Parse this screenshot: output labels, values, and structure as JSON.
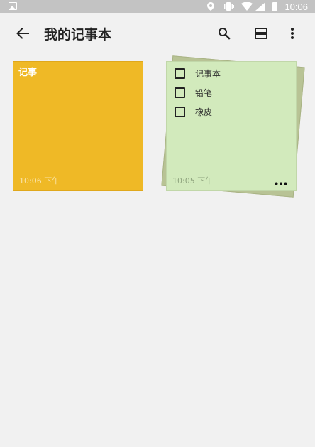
{
  "status_bar": {
    "time": "10:06",
    "icons": [
      "gallery-icon",
      "location-icon",
      "vibrate-icon",
      "wifi-icon",
      "signal-icon",
      "battery-icon"
    ]
  },
  "toolbar": {
    "title": "我的记事本",
    "icons": [
      "back-arrow-icon",
      "search-icon",
      "view-layout-icon",
      "more-vert-icon"
    ]
  },
  "notes": [
    {
      "title": "记事",
      "time": "10:06 下午",
      "color": "#efb926"
    },
    {
      "type": "checklist",
      "items": [
        {
          "label": "记事本",
          "checked": false
        },
        {
          "label": "铅笔",
          "checked": false
        },
        {
          "label": "橡皮",
          "checked": false
        }
      ],
      "time": "10:05 下午",
      "color": "#d2eabc",
      "stacked": true
    }
  ],
  "colors": {
    "background": "#f1f1f1",
    "status_bar": "#c3c3c3",
    "stack_back": "#b8c395"
  }
}
